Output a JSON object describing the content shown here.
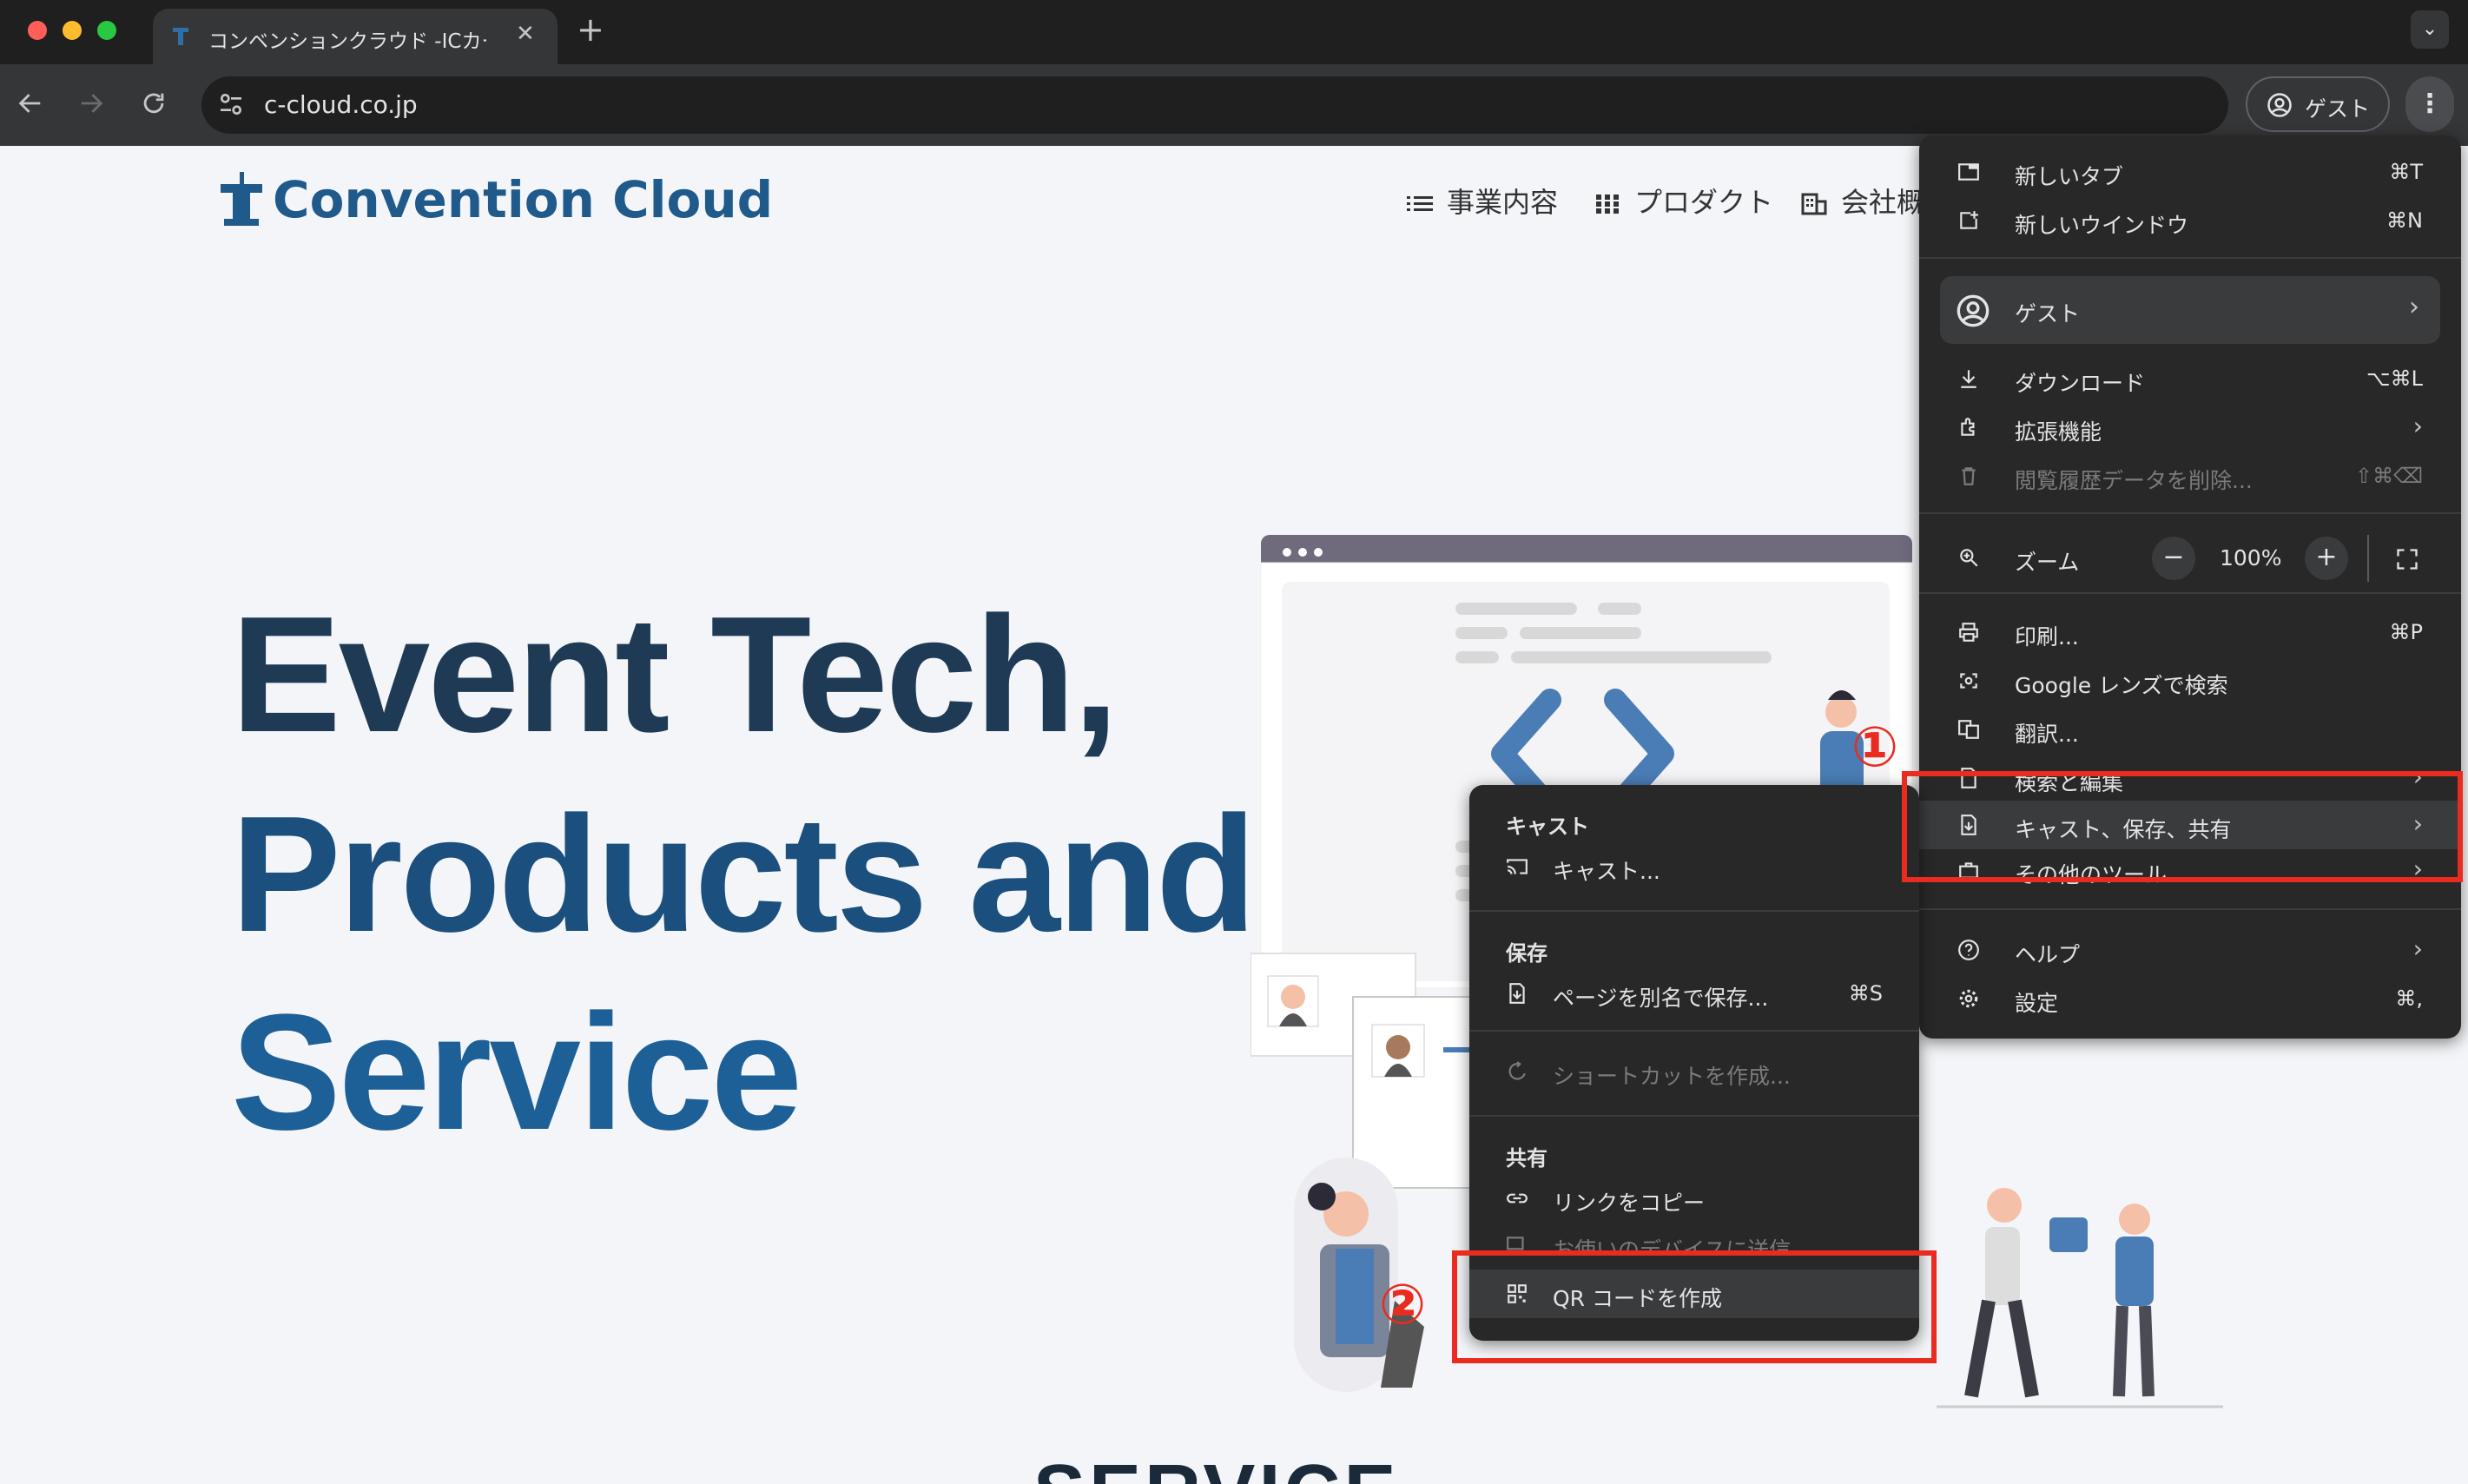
{
  "browser": {
    "tab_title": "コンベンションクラウド -ICカー",
    "tab_close": "✕",
    "new_tab": "+",
    "url": "c-cloud.co.jp",
    "profile_label": "ゲスト",
    "tab_search": "⌄"
  },
  "site": {
    "logo_text": "Convention Cloud",
    "nav": [
      "事業内容",
      "プロダクト",
      "会社概"
    ],
    "hero_lines": [
      "Event Tech,",
      "Products and",
      "Service"
    ],
    "section_heading": "SERVICE",
    "code_brackets": "< >"
  },
  "chrome_menu": {
    "items": [
      {
        "label": "新しいタブ",
        "shortcut": "⌘T"
      },
      {
        "label": "新しいウインドウ",
        "shortcut": "⌘N"
      },
      {
        "label": "ゲスト"
      },
      {
        "label": "ダウンロード",
        "shortcut": "⌥⌘L"
      },
      {
        "label": "拡張機能"
      },
      {
        "label": "閲覧履歴データを削除...",
        "shortcut": "⇧⌘⌫"
      },
      {
        "label": "ズーム"
      },
      {
        "label": "印刷...",
        "shortcut": "⌘P"
      },
      {
        "label": "Google レンズで検索"
      },
      {
        "label": "翻訳..."
      },
      {
        "label": "検索と編集"
      },
      {
        "label": "キャスト、保存、共有"
      },
      {
        "label": "その他のツール"
      },
      {
        "label": "ヘルプ"
      },
      {
        "label": "設定",
        "shortcut": "⌘,"
      }
    ],
    "zoom": {
      "minus": "−",
      "value": "100%",
      "plus": "+"
    }
  },
  "submenu": {
    "sections": [
      {
        "title": "キャスト",
        "items": [
          {
            "label": "キャスト..."
          }
        ]
      },
      {
        "title": "保存",
        "items": [
          {
            "label": "ページを別名で保存...",
            "shortcut": "⌘S"
          },
          {
            "label": "ショートカットを作成..."
          }
        ]
      },
      {
        "title": "共有",
        "items": [
          {
            "label": "リンクをコピー"
          },
          {
            "label": "お使いのデバイスに送信"
          },
          {
            "label": "QR コードを作成"
          }
        ]
      }
    ]
  },
  "annotations": {
    "callout_1": "①",
    "callout_2": "②",
    "color": "#ea2b1f"
  }
}
